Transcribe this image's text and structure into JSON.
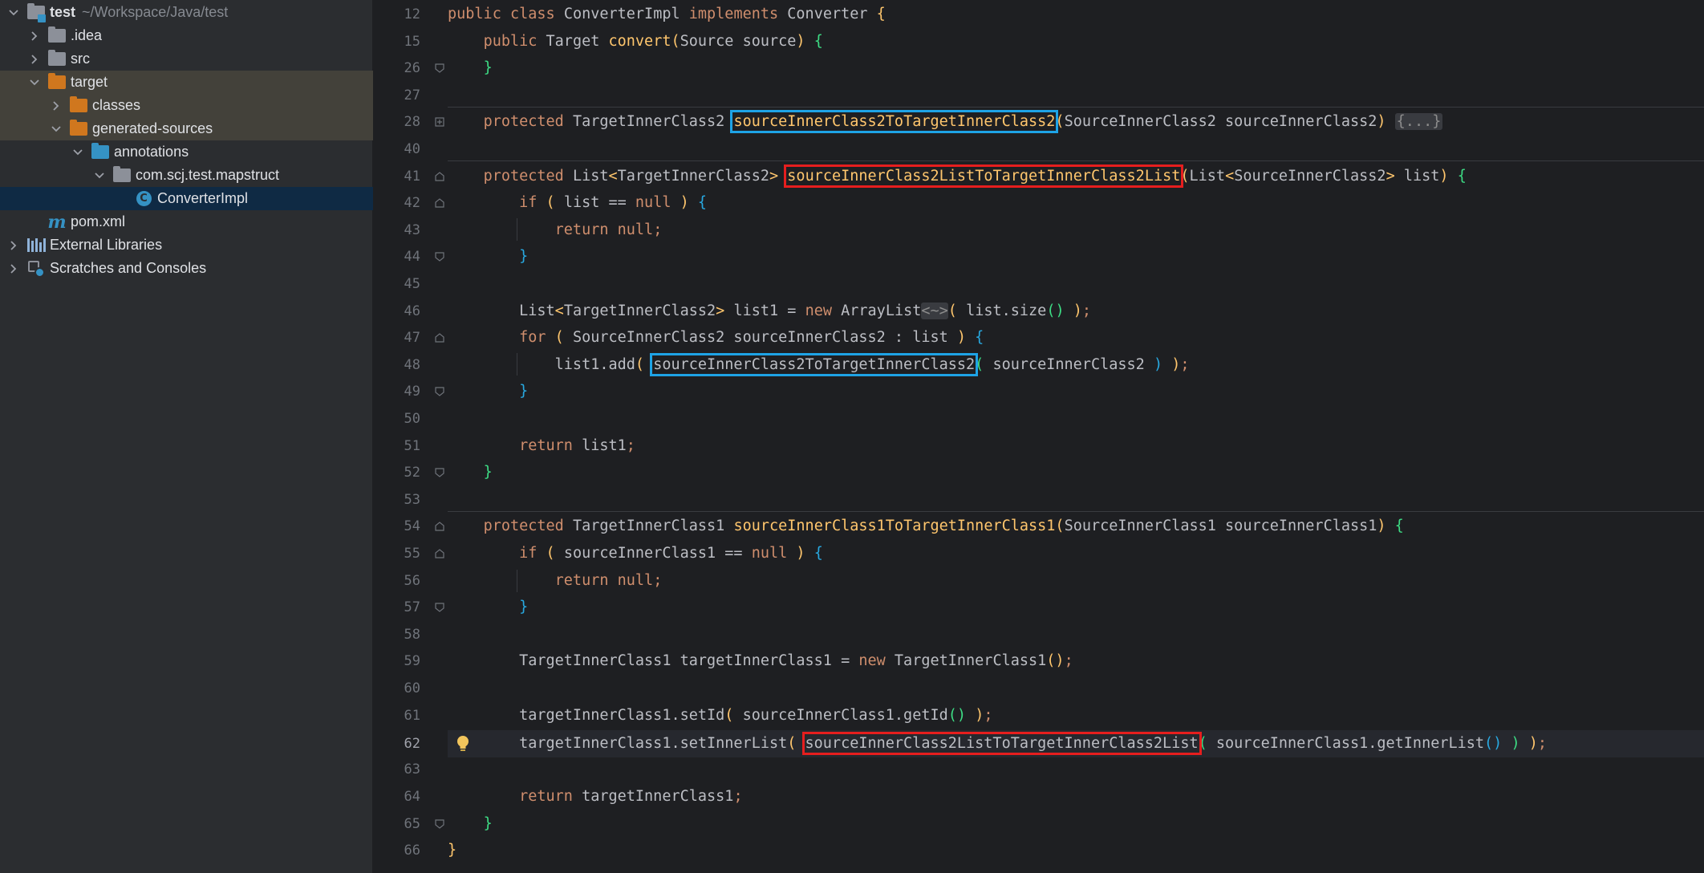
{
  "project_tree": {
    "root": {
      "name": "test",
      "path": "~/Workspace/Java/test"
    },
    "items": [
      {
        "label": ".idea"
      },
      {
        "label": "src"
      },
      {
        "label": "target"
      },
      {
        "label": "classes"
      },
      {
        "label": "generated-sources"
      },
      {
        "label": "annotations"
      },
      {
        "label": "com.scj.test.mapstruct"
      },
      {
        "label": "ConverterImpl"
      },
      {
        "label": "pom.xml"
      },
      {
        "label": "External Libraries"
      },
      {
        "label": "Scratches and Consoles"
      }
    ]
  },
  "editor": {
    "line_numbers": [
      "12",
      "15",
      "26",
      "27",
      "28",
      "40",
      "41",
      "42",
      "43",
      "44",
      "45",
      "46",
      "47",
      "48",
      "49",
      "50",
      "51",
      "52",
      "53",
      "54",
      "55",
      "56",
      "57",
      "58",
      "59",
      "60",
      "61",
      "62",
      "63",
      "64",
      "65",
      "66"
    ],
    "current_line": "62",
    "folded_placeholder": "{...}",
    "diamond": "<~>",
    "tokens": {
      "kw_public": "public",
      "kw_class": "class",
      "kw_implements": "implements",
      "kw_protected": "protected",
      "kw_if": "if",
      "kw_null": "null",
      "kw_return": "return",
      "kw_new": "new",
      "kw_for": "for",
      "t_ConverterImpl": "ConverterImpl",
      "t_Converter": "Converter",
      "t_Target": "Target",
      "t_convert": "convert",
      "t_Source_source": "Source source",
      "t_TargetInnerClass2": "TargetInnerClass2",
      "t_TargetInnerClass1": "TargetInnerClass1",
      "m_s2t2": "sourceInnerClass2ToTargetInnerClass2",
      "m_s2lt2l": "sourceInnerClass2ListToTargetInnerClass2List",
      "m_s1t1": "sourceInnerClass1ToTargetInnerClass1",
      "p_sic2": "SourceInnerClass2 sourceInnerClass2",
      "p_sic1": "SourceInnerClass1 sourceInnerClass1",
      "t_List": "List",
      "t_SourceInnerClass2": "SourceInnerClass2",
      "t_list": "list",
      "t_list_eq": "list ==",
      "t_list1_decl": "list1 =",
      "t_ArrayList": "ArrayList",
      "t_list_size": "list.size",
      "t_for_var": "SourceInnerClass2 sourceInnerClass2 : list",
      "t_list1_add": "list1.add",
      "t_sic2_arg": "sourceInnerClass2",
      "t_list1": "list1",
      "t_sic1_eq": "sourceInnerClass1 ==",
      "t_tic1_decl": "TargetInnerClass1 targetInnerClass1 =",
      "t_TargetInnerClass1_ctor": "TargetInnerClass1",
      "t_setId": "targetInnerClass1.setId",
      "t_getId": "sourceInnerClass1.getId",
      "t_setInnerList": "targetInnerClass1.setInnerList",
      "t_getInnerList": "sourceInnerClass1.getInnerList",
      "t_tic1": "targetInnerClass1"
    },
    "highlight_colors": {
      "blue_box": "#1ea3e6",
      "red_box": "#e61e1e"
    }
  }
}
